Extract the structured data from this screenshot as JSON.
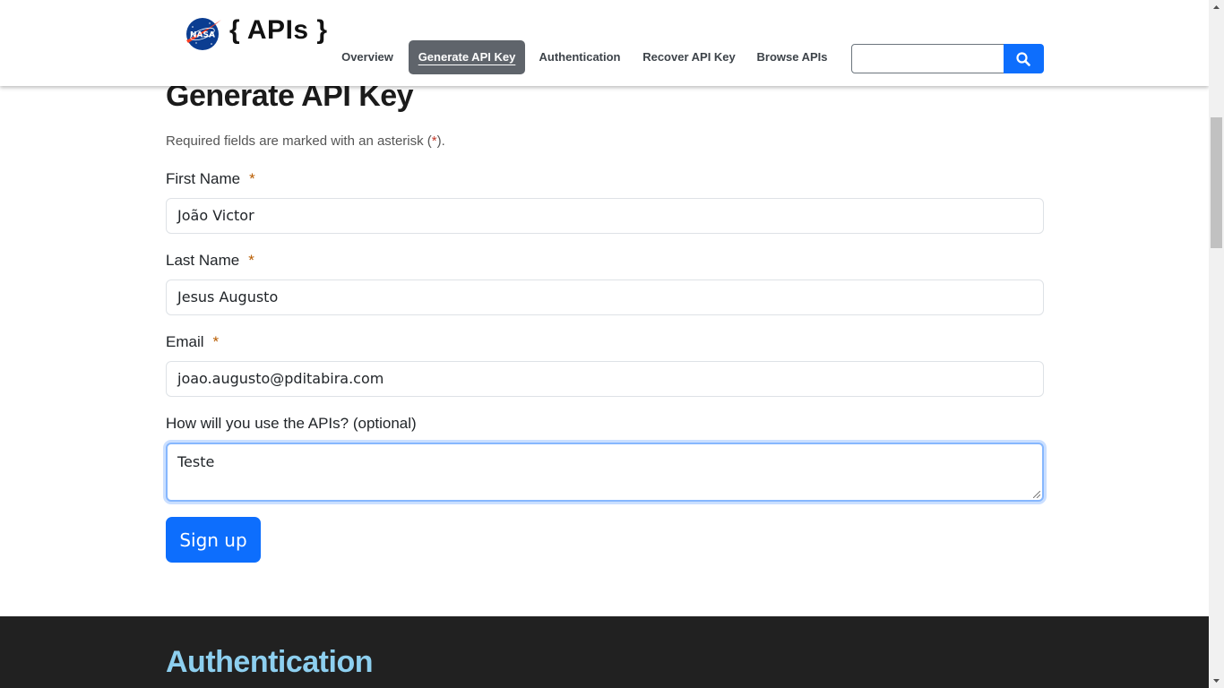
{
  "header": {
    "brand": "{ APIs }",
    "logo_text": "NASA",
    "nav": [
      {
        "label": "Overview"
      },
      {
        "label": "Generate API Key"
      },
      {
        "label": "Authentication"
      },
      {
        "label": "Recover API Key"
      },
      {
        "label": "Browse APIs"
      }
    ],
    "search": {
      "value": "",
      "placeholder": ""
    }
  },
  "form": {
    "title": "Generate API Key",
    "required_note_before": "Required fields are marked with an asterisk (",
    "required_note_star": "*",
    "required_note_after": ").",
    "first_name": {
      "label": "First Name",
      "asterisk": "*",
      "value": "João Victor"
    },
    "last_name": {
      "label": "Last Name",
      "asterisk": "*",
      "value": "Jesus Augusto"
    },
    "email": {
      "label": "Email",
      "asterisk": "*",
      "value": "joao.augusto@pditabira.com"
    },
    "usage": {
      "label": "How will you use the APIs? (optional)",
      "value": "Teste"
    },
    "submit_label": "Sign up"
  },
  "next_section": {
    "title": "Authentication"
  },
  "colors": {
    "primary": "#0d6efd",
    "nav_active": "#5f646b",
    "dark_section": "#212121",
    "dark_title": "#8dcfef"
  }
}
